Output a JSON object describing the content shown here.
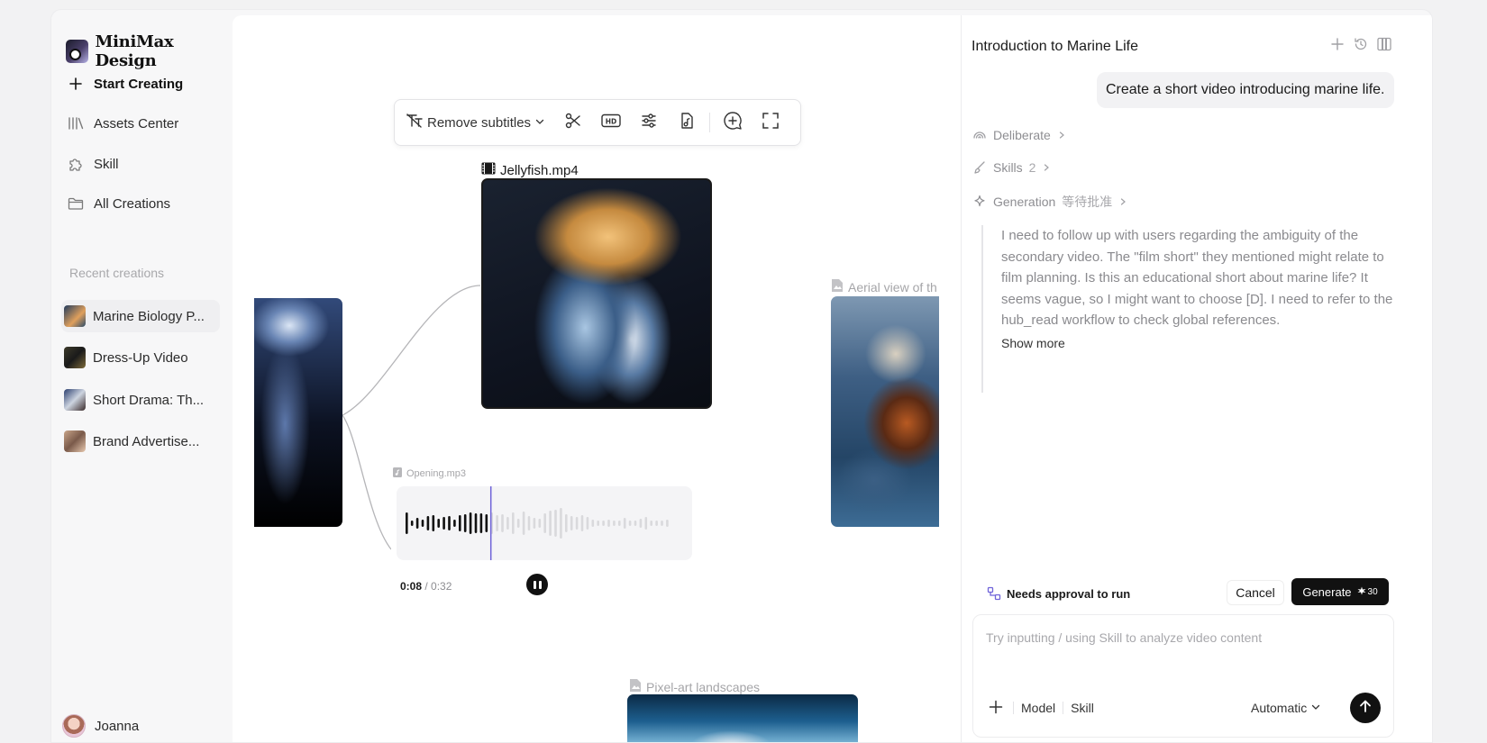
{
  "app": {
    "name": "MiniMax Design"
  },
  "sidebar": {
    "nav": [
      {
        "label": "Start Creating",
        "icon": "plus-icon"
      },
      {
        "label": "Assets Center",
        "icon": "library-icon"
      },
      {
        "label": "Skill",
        "icon": "puzzle-icon"
      },
      {
        "label": "All Creations",
        "icon": "folder-icon"
      }
    ],
    "recent_title": "Recent creations",
    "recent": [
      {
        "label": "Marine Biology P..."
      },
      {
        "label": "Dress-Up Video"
      },
      {
        "label": "Short Drama: Th..."
      },
      {
        "label": "Brand Advertise..."
      }
    ],
    "user": {
      "name": "Joanna"
    }
  },
  "canvas": {
    "toolbar": {
      "subtitle_label": "Remove subtitles"
    },
    "nodes": {
      "jellyfish": {
        "label": "Jellyfish.mp4"
      },
      "aerial": {
        "label": "Aerial view of th"
      },
      "audio": {
        "label": "Opening.mp3",
        "current": "0:08",
        "total": " / 0:32",
        "progress": 0.25
      },
      "pixel": {
        "label": "Pixel-art landscapes"
      }
    }
  },
  "panel": {
    "title": "Introduction to Marine Life",
    "user_message": "Create a short video introducing marine life.",
    "steps": {
      "deliberate": "Deliberate",
      "skills": "Skills",
      "skills_count": "2",
      "generation": "Generation",
      "generation_status": "等待批准"
    },
    "thought": "I need to follow up with users regarding the ambiguity of the secondary video. The \"film short\" they mentioned might relate to film planning. Is this an educational short about marine life? It seems vague, so I might want to choose [D]. I need to refer to the hub_read workflow to check global references.",
    "show_more": "Show more",
    "approval": {
      "text": "Needs approval to run",
      "cancel": "Cancel",
      "generate": "Generate",
      "cost": "30"
    },
    "composer": {
      "placeholder": "Try inputting / using Skill to analyze video content",
      "model": "Model",
      "skill": "Skill",
      "mode": "Automatic"
    }
  }
}
